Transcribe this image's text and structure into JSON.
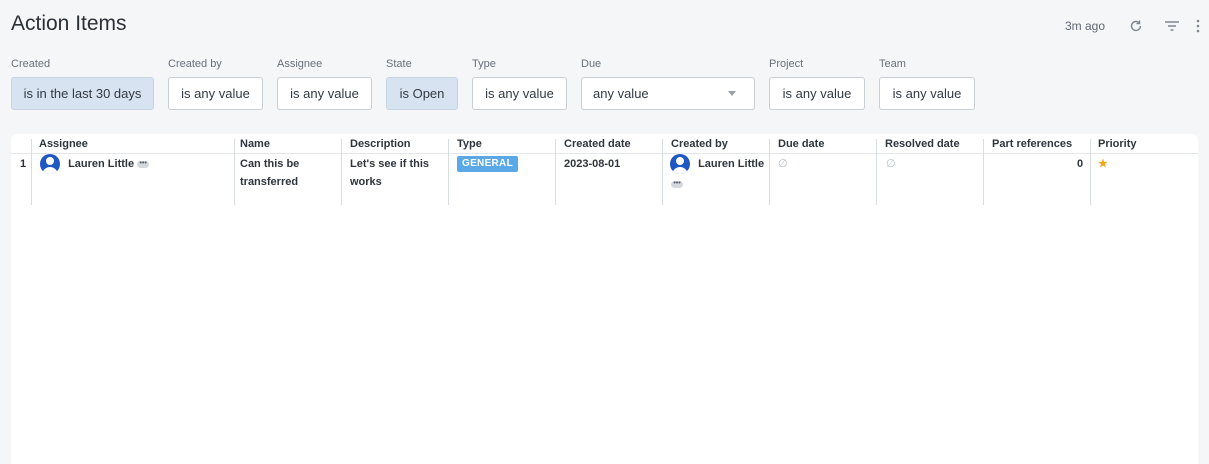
{
  "header": {
    "title": "Action Items",
    "updated": "3m ago",
    "refresh_icon": "refresh-icon",
    "filter_icon": "filter-icon",
    "more_icon": "kebab-menu-icon"
  },
  "filters": [
    {
      "label": "Created",
      "value": "is in the last 30 days",
      "active": true
    },
    {
      "label": "Created by",
      "value": "is any value",
      "active": false
    },
    {
      "label": "Assignee",
      "value": "is any value",
      "active": false
    },
    {
      "label": "State",
      "value": "is Open",
      "active": true
    },
    {
      "label": "Type",
      "value": "is any value",
      "active": false
    },
    {
      "label": "Due",
      "value": "any value",
      "active": false
    },
    {
      "label": "Project",
      "value": "is any value",
      "active": false
    },
    {
      "label": "Team",
      "value": "is any value",
      "active": false
    }
  ],
  "table": {
    "columns": [
      "Assignee",
      "Name",
      "Description",
      "Type",
      "Created date",
      "Created by",
      "Due date",
      "Resolved date",
      "Part references",
      "Priority"
    ],
    "rows": [
      {
        "num": "1",
        "assignee": "Lauren Little",
        "name_line1": "Can this be",
        "name_line2": "transferred",
        "desc_line1": "Let's see if this",
        "desc_line2": "works",
        "type": "GENERAL",
        "created_date": "2023-08-01",
        "created_by": "Lauren Little",
        "due_date": "∅",
        "resolved_date": "∅",
        "part_references": "0",
        "priority": "★"
      }
    ]
  },
  "colors": {
    "accent": "#1f57c3",
    "badge": "#5aa9e6",
    "active_filter": "#d7e3f1",
    "star": "#f2a623"
  }
}
